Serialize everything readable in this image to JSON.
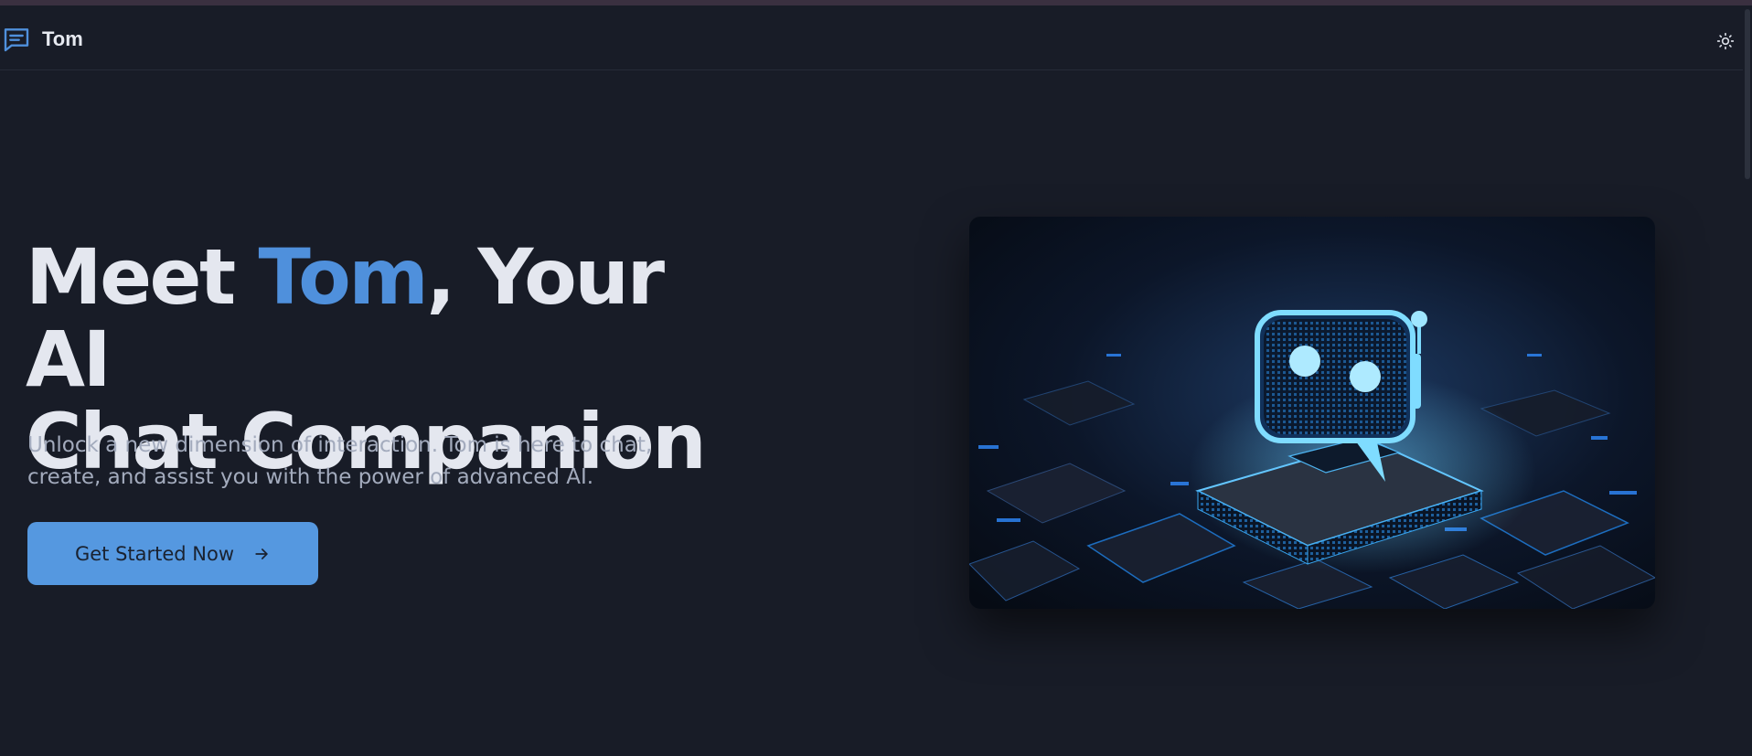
{
  "navbar": {
    "brand_name": "Tom",
    "logo_icon": "message-square-icon",
    "theme_icon": "sun-icon"
  },
  "hero": {
    "title_part1": "Meet ",
    "title_accent": "Tom",
    "title_part2": ", Your AI",
    "title_line2": "Chat Companion",
    "description": "Unlock a new dimension of interaction. Tom is here to chat, create, and assist you with the power of advanced AI.",
    "cta_label": "Get Started Now",
    "cta_icon": "arrow-right-icon",
    "image_subject": "ai-chatbot-robot-illustration"
  },
  "colors": {
    "background": "#181c27",
    "accent": "#4f90dc",
    "button": "#5598e0",
    "heading": "#e4e7ef",
    "body_text": "#a3abbd"
  }
}
